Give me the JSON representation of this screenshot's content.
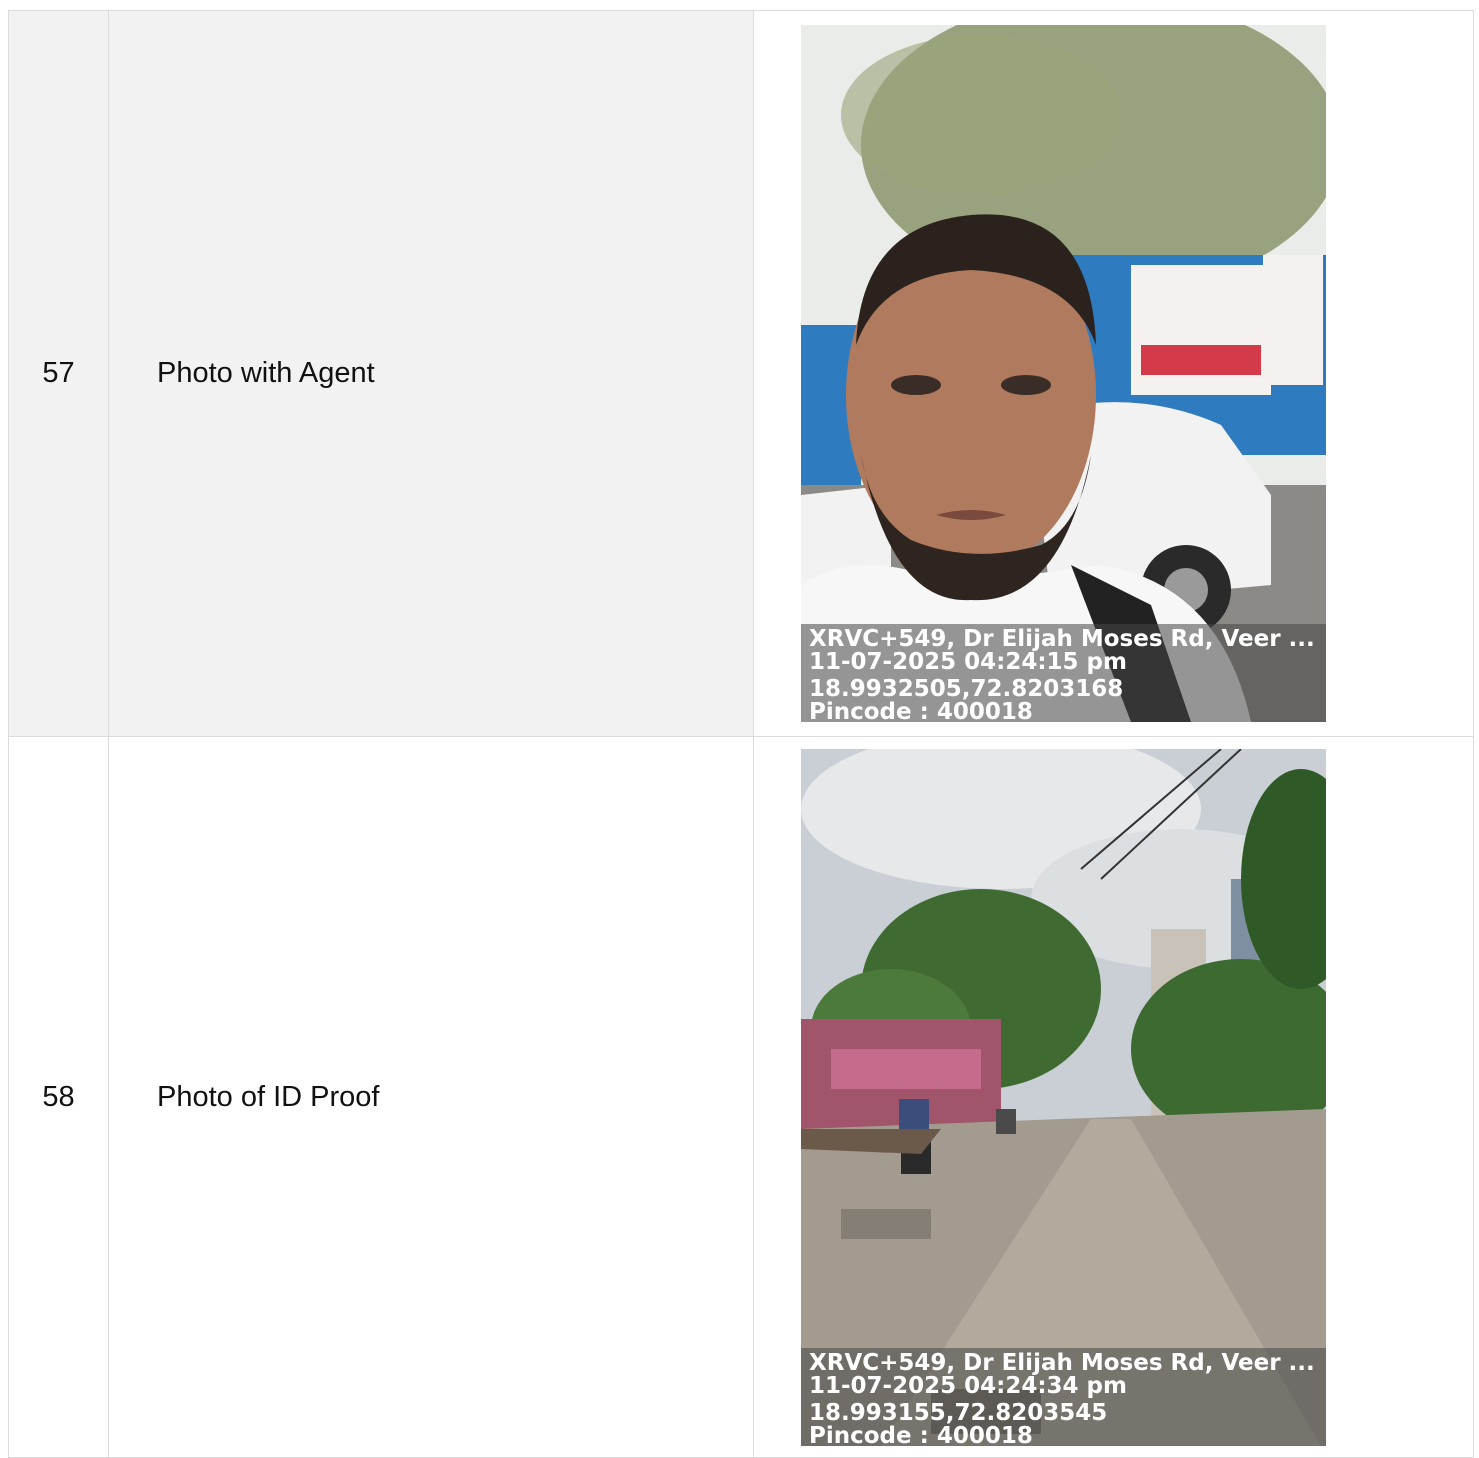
{
  "rows": [
    {
      "no": "57",
      "label": "Photo with Agent",
      "photo": {
        "address": "XRVC+549, Dr Elijah Moses Rd, Veer ...",
        "datetime": "11-07-2025 04:24:15 pm",
        "coords": "18.9932505,72.8203168",
        "pincode": "Pincode : 400018"
      }
    },
    {
      "no": "58",
      "label": "Photo of ID Proof",
      "photo": {
        "address": "XRVC+549, Dr Elijah Moses Rd, Veer ...",
        "datetime": "11-07-2025 04:24:34 pm",
        "coords": "18.993155,72.8203545",
        "pincode": "Pincode : 400018"
      }
    }
  ]
}
